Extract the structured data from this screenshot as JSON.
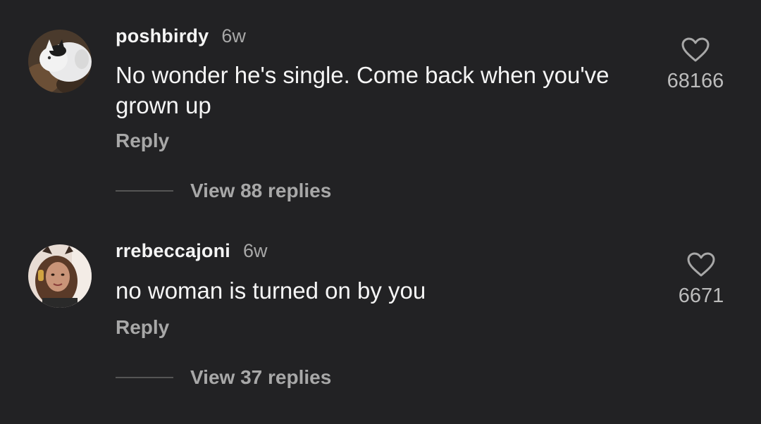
{
  "comments": [
    {
      "username": "poshbirdy",
      "time": "6w",
      "text": "No wonder he's single. Come back when you've grown up",
      "reply_label": "Reply",
      "view_replies_label": "View 88 replies",
      "likes": "68166",
      "avatar": "white-cat-avatar"
    },
    {
      "username": "rrebeccajoni",
      "time": "6w",
      "text": "no woman is turned on by you",
      "reply_label": "Reply",
      "view_replies_label": "View 37 replies",
      "likes": "6671",
      "avatar": "user-photo-avatar"
    }
  ],
  "colors": {
    "background": "#222224",
    "primary_text": "#f5f5f5",
    "secondary_text": "#a8a8a8"
  },
  "icons": {
    "like": "heart-outline-icon"
  }
}
